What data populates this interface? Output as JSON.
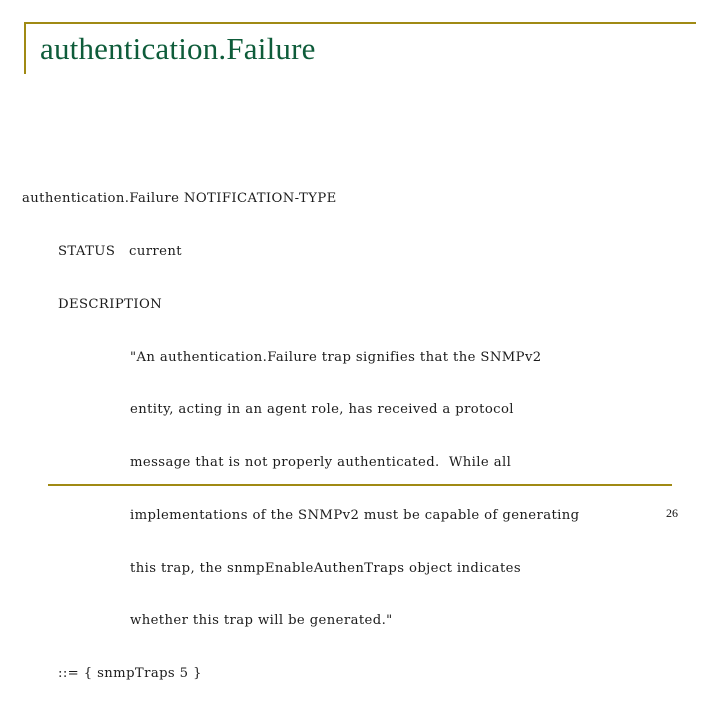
{
  "slide": {
    "title": "authentication.Failure",
    "page_number": "26",
    "accent_color": "#a08a14",
    "title_color": "#0e5c3a",
    "body": {
      "lines": [
        "authentication.Failure NOTIFICATION-TYPE",
        "STATUS   current",
        "DESCRIPTION",
        "\"An authentication.Failure trap signifies that the SNMPv2",
        "entity, acting in an agent role, has received a protocol",
        "message that is not properly authenticated.  While all",
        "implementations of the SNMPv2 must be capable of generating",
        "this trap, the snmpEnableAuthenTraps object indicates",
        "whether this trap will be generated.\"",
        "::= { snmpTraps 5 }"
      ]
    }
  }
}
